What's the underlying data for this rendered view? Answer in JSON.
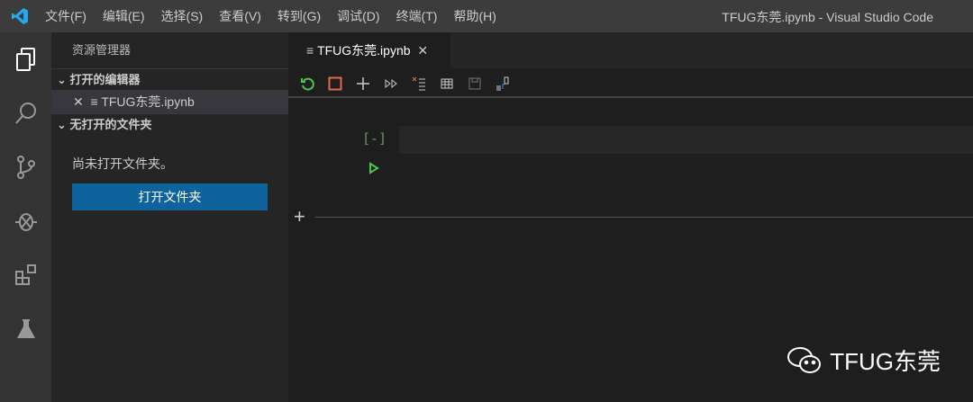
{
  "titlebar": {
    "menus": [
      "文件(F)",
      "编辑(E)",
      "选择(S)",
      "查看(V)",
      "转到(G)",
      "调试(D)",
      "终端(T)",
      "帮助(H)"
    ],
    "title": "TFUG东莞.ipynb - Visual Studio Code"
  },
  "sidebar": {
    "header": "资源管理器",
    "open_editors": "打开的编辑器",
    "open_file": "TFUG东莞.ipynb",
    "no_folder_section": "无打开的文件夹",
    "no_folder_msg": "尚未打开文件夹。",
    "open_folder_button": "打开文件夹"
  },
  "editor": {
    "tab_label": "TFUG东莞.ipynb",
    "cell_prompt": "[-]"
  },
  "watermark": "TFUG东莞",
  "colors": {
    "accent": "#0e639c",
    "restart": "#4ec44e",
    "stop": "#e0694e",
    "prompt": "#6a9955"
  }
}
